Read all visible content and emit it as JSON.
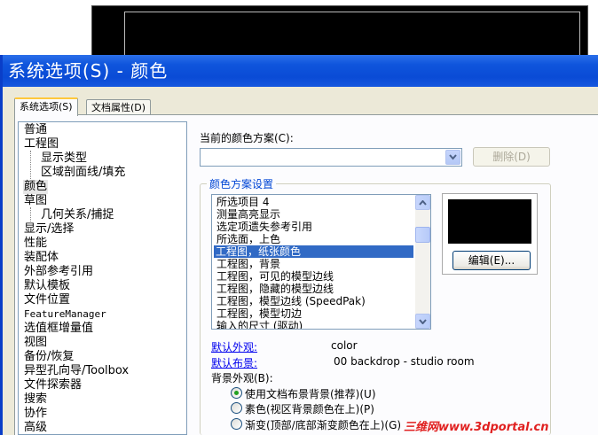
{
  "window_title": "系统选项(S) - 颜色",
  "tabs": [
    {
      "label": "系统选项(S)",
      "active": true
    },
    {
      "label": "文档属性(D)",
      "active": false
    }
  ],
  "tree": [
    {
      "label": "普通",
      "level": 0
    },
    {
      "label": "工程图",
      "level": 0
    },
    {
      "label": "显示类型",
      "level": 1
    },
    {
      "label": "区域剖面线/填充",
      "level": 1
    },
    {
      "label": "颜色",
      "level": 0,
      "selected": true
    },
    {
      "label": "草图",
      "level": 0
    },
    {
      "label": "几何关系/捕捉",
      "level": 1
    },
    {
      "label": "显示/选择",
      "level": 0
    },
    {
      "label": "性能",
      "level": 0
    },
    {
      "label": "装配体",
      "level": 0
    },
    {
      "label": "外部参考引用",
      "level": 0
    },
    {
      "label": "默认模板",
      "level": 0
    },
    {
      "label": "文件位置",
      "level": 0
    },
    {
      "label": "FeatureManager",
      "level": 0
    },
    {
      "label": "选值框增量值",
      "level": 0
    },
    {
      "label": "视图",
      "level": 0
    },
    {
      "label": "备份/恢复",
      "level": 0
    },
    {
      "label": "异型孔向导/Toolbox",
      "level": 0
    },
    {
      "label": "文件探索器",
      "level": 0
    },
    {
      "label": "搜索",
      "level": 0
    },
    {
      "label": "协作",
      "level": 0
    },
    {
      "label": "高级",
      "level": 0
    }
  ],
  "color_scheme": {
    "label": "当前的颜色方案(C):",
    "value": "",
    "delete_button": "删除(D)"
  },
  "settings_group": {
    "title": "颜色方案设置",
    "items": [
      "所选项目 4",
      "测量高亮显示",
      "选定项遗失参考引用",
      "所选面，上色",
      "工程图，纸张颜色",
      "工程图，背景",
      "工程图，可见的模型边线",
      "工程图，隐藏的模型边线",
      "工程图，模型边线 (SpeedPak)",
      "工程图，模型切边",
      "输入的尺寸 (驱动)"
    ],
    "selected_index": 4,
    "swatch_color": "#000000",
    "edit_button": "编辑(E)..."
  },
  "default_appearance": {
    "label": "默认外观:",
    "value": "color"
  },
  "default_layout": {
    "label": "默认布景:",
    "value": "00 backdrop - studio room"
  },
  "background": {
    "label": "背景外观(B):",
    "options": [
      {
        "label": "使用文档布景背景(推荐)(U)",
        "checked": true
      },
      {
        "label": "素色(视区背景颜色在上)(P)",
        "checked": false
      },
      {
        "label": "渐变(顶部/底部渐变颜色在上)(G)",
        "checked": false
      }
    ]
  },
  "watermark": "三维网www.3dportal.cn",
  "colors": {
    "title_bar": "#0a4bd6",
    "selection": "#316ac5",
    "dialog_bg": "#ece9d8",
    "watermark": "#e02020"
  }
}
